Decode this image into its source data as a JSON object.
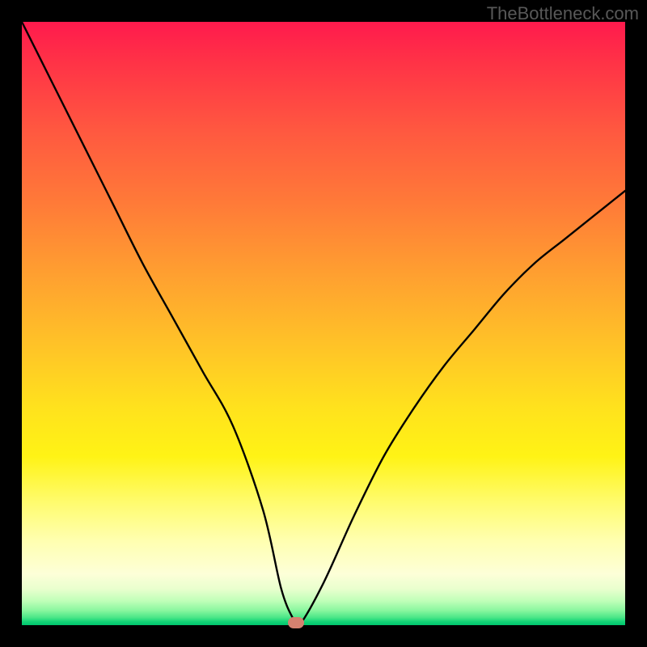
{
  "watermark": "TheBottleneck.com",
  "chart_data": {
    "type": "line",
    "title": "",
    "xlabel": "",
    "ylabel": "",
    "xlim": [
      0,
      1
    ],
    "ylim": [
      0,
      1
    ],
    "legend": false,
    "notes": "Background is a vertical red→yellow→green gradient. A single black V-shaped curve reaches y≈0 near x≈0.44–0.46. A small rounded salmon marker sits at the valley floor (x≈0.455, y≈0).",
    "series": [
      {
        "name": "bottleneck-curve",
        "x": [
          0.0,
          0.05,
          0.1,
          0.15,
          0.2,
          0.25,
          0.3,
          0.35,
          0.4,
          0.43,
          0.45,
          0.46,
          0.5,
          0.55,
          0.6,
          0.65,
          0.7,
          0.75,
          0.8,
          0.85,
          0.9,
          0.95,
          1.0
        ],
        "y": [
          1.0,
          0.9,
          0.8,
          0.7,
          0.6,
          0.51,
          0.42,
          0.33,
          0.19,
          0.06,
          0.01,
          0.0,
          0.07,
          0.18,
          0.28,
          0.36,
          0.43,
          0.49,
          0.55,
          0.6,
          0.64,
          0.68,
          0.72
        ]
      }
    ],
    "marker": {
      "x": 0.455,
      "y": 0.004,
      "shape": "rounded-rect",
      "color": "#d58170"
    }
  },
  "colors": {
    "frame": "#000000",
    "curve": "#000000",
    "marker": "#d58170",
    "watermark": "#585858"
  }
}
